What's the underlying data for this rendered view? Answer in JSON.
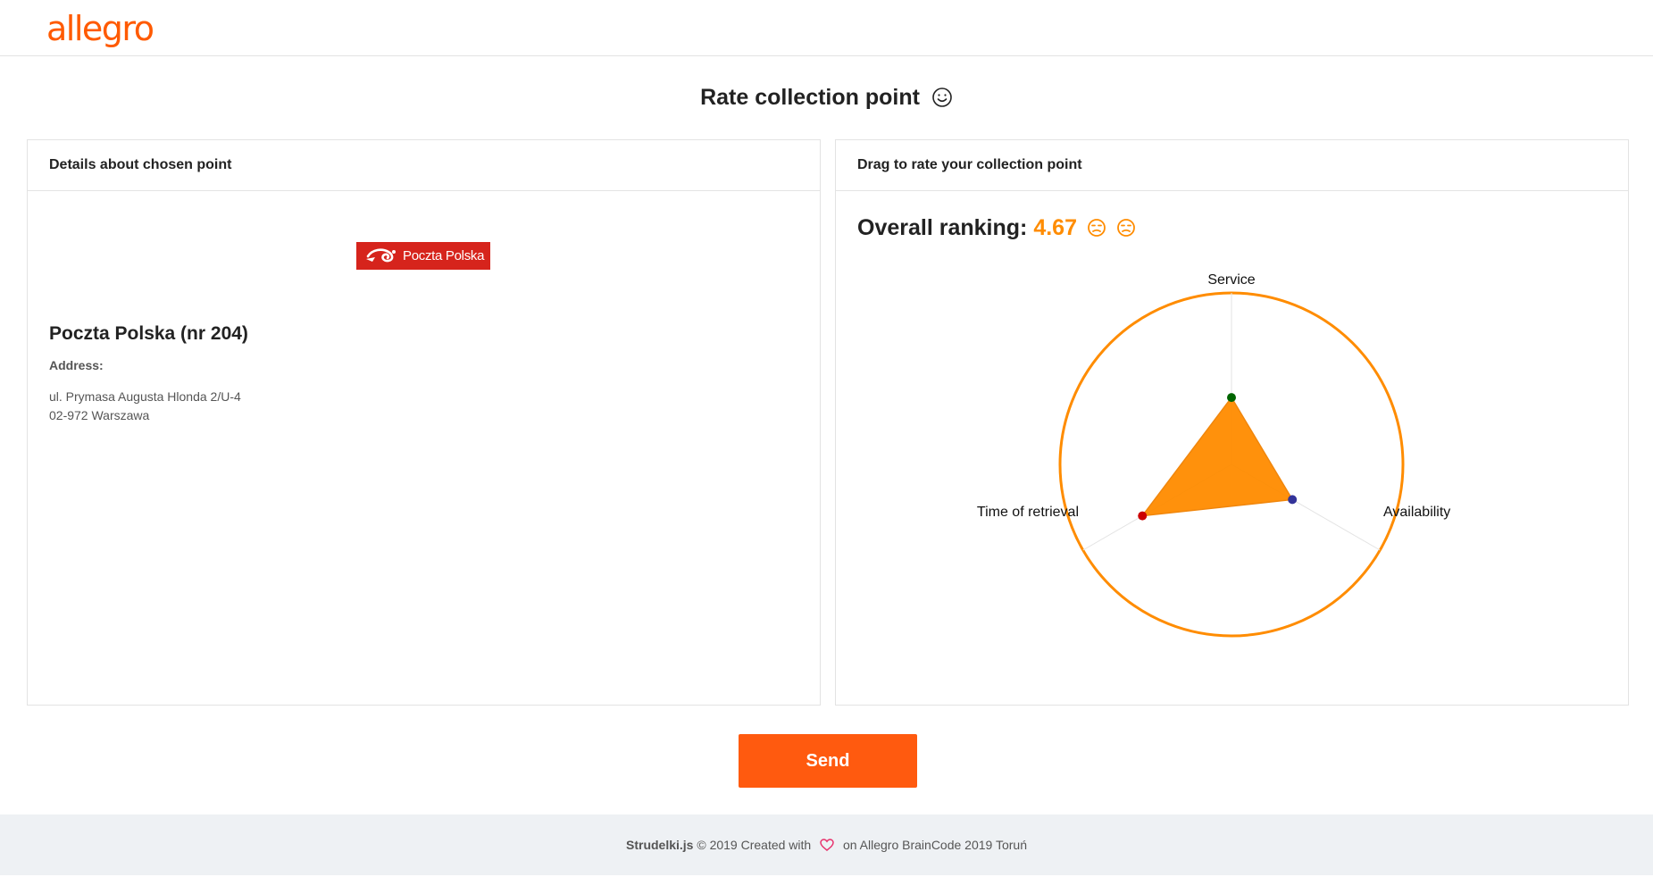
{
  "header": {
    "logo_text": "allegro"
  },
  "page": {
    "title": "Rate collection point",
    "title_icon": "smiley-icon"
  },
  "details_panel": {
    "heading": "Details about chosen point",
    "carrier_logo_text": "Poczta Polska",
    "point_name": "Poczta Polska (nr 204)",
    "address_label": "Address:",
    "address_line1": "ul. Prymasa Augusta Hlonda 2/U-4",
    "address_line2": "02-972 Warszawa"
  },
  "rating_panel": {
    "heading": "Drag to rate your collection point",
    "ranking_label": "Overall ranking:",
    "ranking_value": "4.67",
    "ranking_icons": [
      "unamused-face-icon",
      "unamused-face-icon"
    ],
    "axes": [
      {
        "label": "Service",
        "value": 0.39,
        "handle_color": "#006400"
      },
      {
        "label": "Availability",
        "value": 0.41,
        "handle_color": "#333399"
      },
      {
        "label": "Time of retrieval",
        "value": 0.6,
        "handle_color": "#cc0000"
      }
    ],
    "colors": {
      "accent": "#ff8c00",
      "fill": "#ff8c00"
    }
  },
  "actions": {
    "send_label": "Send"
  },
  "footer": {
    "brand": "Strudelki.js",
    "text_before_heart": "© 2019 Created with",
    "text_after_heart": "on Allegro BrainCode 2019 Toruń",
    "heart_color": "#e8336d"
  }
}
